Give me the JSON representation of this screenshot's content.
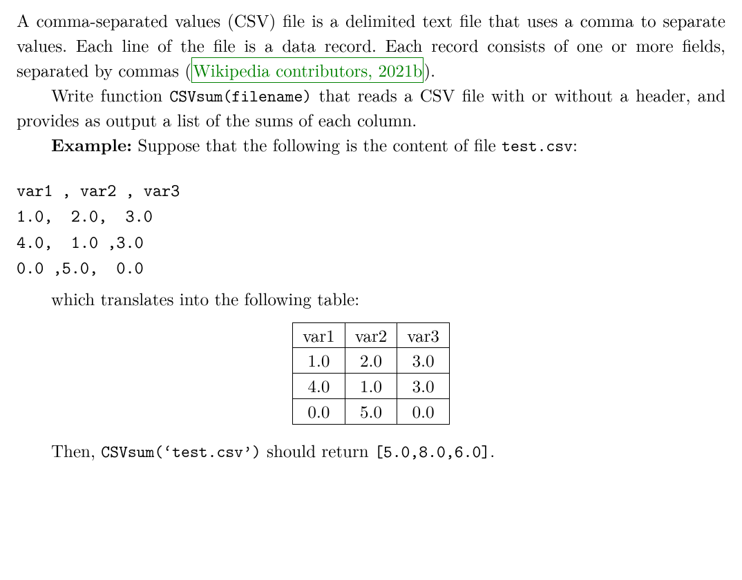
{
  "para1": {
    "pre_cite": "A comma-separated values (CSV) file is a delimited text file that uses a comma to separate values. Each line of the file is a data record. Each record consists of one or more fields, separated by commas (",
    "cite_text": "Wikipedia contributors, 2021b",
    "post_cite": ")."
  },
  "para2": {
    "t1": "Write function ",
    "code1": "CSVsum(filename)",
    "t2": " that reads a CSV file with or without a header, and provides as output a list of the sums of each column."
  },
  "para3": {
    "bold": "Example:",
    "t1": " Suppose that the following is the content of file ",
    "code1": "test.csv",
    "t2": ":"
  },
  "csv_raw": "var1 , var2 , var3\n1.0,  2.0,  3.0\n4.0,  1.0 ,3.0\n0.0 ,5.0,  0.0",
  "table_caption": "which translates into the following table:",
  "chart_data": {
    "type": "table",
    "headers": [
      "var1",
      "var2",
      "var3"
    ],
    "rows": [
      [
        "1.0",
        "2.0",
        "3.0"
      ],
      [
        "4.0",
        "1.0",
        "3.0"
      ],
      [
        "0.0",
        "5.0",
        "0.0"
      ]
    ]
  },
  "para5": {
    "t1": "Then, ",
    "code1": "CSVsum(‘test.csv’)",
    "t2": " should return ",
    "code2": "[5.0,8.0,6.0]",
    "t3": "."
  }
}
